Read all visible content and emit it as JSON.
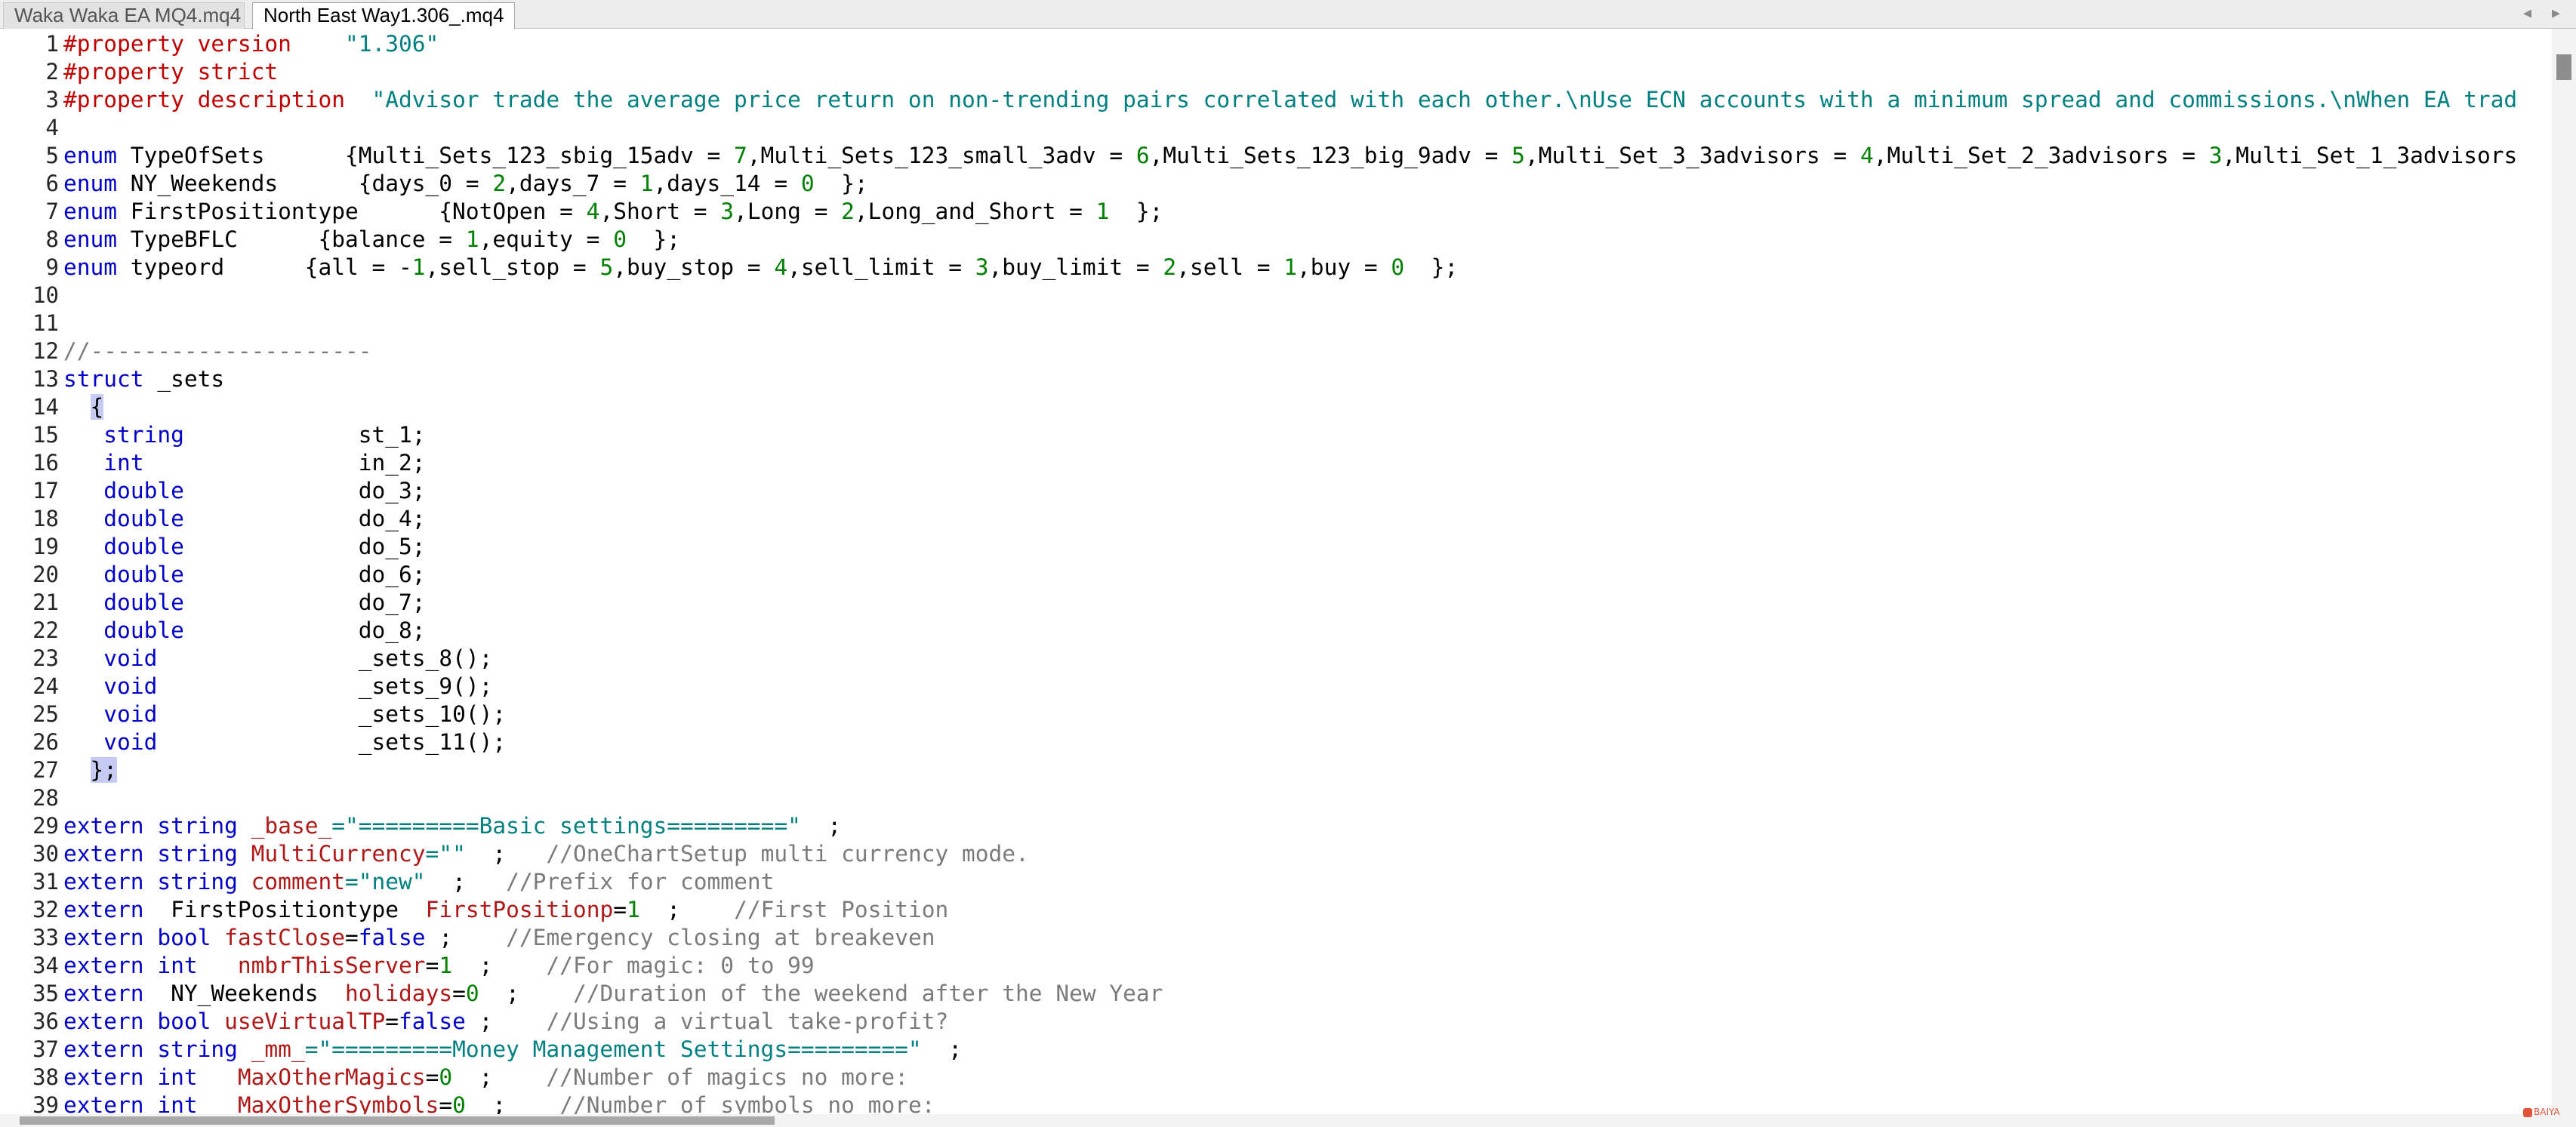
{
  "tabs": [
    {
      "label": "Waka Waka EA MQ4.mq4",
      "active": false
    },
    {
      "label": "North East Way1.306_.mq4",
      "active": true
    }
  ],
  "tab_nav": {
    "prev": "◂",
    "next": "▸"
  },
  "colors": {
    "keyword": "#0000c8",
    "property": "#c00000",
    "string": "#008080",
    "number": "#008000",
    "comment": "#7b7b7b",
    "variable": "#b01818",
    "brace_highlight": "#c5cbf2"
  },
  "lines": [
    [
      [
        "pr",
        "#property version"
      ],
      [
        "",
        "    "
      ],
      [
        "st",
        "\"1.306\""
      ]
    ],
    [
      [
        "pr",
        "#property strict"
      ]
    ],
    [
      [
        "pr",
        "#property description"
      ],
      [
        "",
        "  "
      ],
      [
        "st",
        "\"Advisor trade the average price return on non-trending pairs correlated with each other.\\nUse ECN accounts with a minimum spread and commissions.\\nWhen EA trad"
      ]
    ],
    [],
    [
      [
        "kw",
        "enum"
      ],
      [
        "",
        " TypeOfSets      {Multi_Sets_123_sbig_15adv = "
      ],
      [
        "nm",
        "7"
      ],
      [
        "",
        ",Multi_Sets_123_small_3adv = "
      ],
      [
        "nm",
        "6"
      ],
      [
        "",
        ",Multi_Sets_123_big_9adv = "
      ],
      [
        "nm",
        "5"
      ],
      [
        "",
        ",Multi_Set_3_3advisors = "
      ],
      [
        "nm",
        "4"
      ],
      [
        "",
        ",Multi_Set_2_3advisors = "
      ],
      [
        "nm",
        "3"
      ],
      [
        "",
        ",Multi_Set_1_3advisors"
      ]
    ],
    [
      [
        "kw",
        "enum"
      ],
      [
        "",
        " NY_Weekends      {days_0 = "
      ],
      [
        "nm",
        "2"
      ],
      [
        "",
        ",days_7 = "
      ],
      [
        "nm",
        "1"
      ],
      [
        "",
        ",days_14 = "
      ],
      [
        "nm",
        "0"
      ],
      [
        "",
        "  };"
      ]
    ],
    [
      [
        "kw",
        "enum"
      ],
      [
        "",
        " FirstPositiontype      {NotOpen = "
      ],
      [
        "nm",
        "4"
      ],
      [
        "",
        ",Short = "
      ],
      [
        "nm",
        "3"
      ],
      [
        "",
        ",Long = "
      ],
      [
        "nm",
        "2"
      ],
      [
        "",
        ",Long_and_Short = "
      ],
      [
        "nm",
        "1"
      ],
      [
        "",
        "  };"
      ]
    ],
    [
      [
        "kw",
        "enum"
      ],
      [
        "",
        " TypeBFLC      {balance = "
      ],
      [
        "nm",
        "1"
      ],
      [
        "",
        ",equity = "
      ],
      [
        "nm",
        "0"
      ],
      [
        "",
        "  };"
      ]
    ],
    [
      [
        "kw",
        "enum"
      ],
      [
        "",
        " typeord      {all = -"
      ],
      [
        "nm",
        "1"
      ],
      [
        "",
        ",sell_stop = "
      ],
      [
        "nm",
        "5"
      ],
      [
        "",
        ",buy_stop = "
      ],
      [
        "nm",
        "4"
      ],
      [
        "",
        ",sell_limit = "
      ],
      [
        "nm",
        "3"
      ],
      [
        "",
        ",buy_limit = "
      ],
      [
        "nm",
        "2"
      ],
      [
        "",
        ",sell = "
      ],
      [
        "nm",
        "1"
      ],
      [
        "",
        ",buy = "
      ],
      [
        "nm",
        "0"
      ],
      [
        "",
        "  };"
      ]
    ],
    [],
    [],
    [
      [
        "cm",
        "//---------------------"
      ]
    ],
    [
      [
        "kw",
        "struct"
      ],
      [
        "",
        " _sets"
      ]
    ],
    [
      [
        "",
        "  "
      ],
      [
        "br",
        "{"
      ]
    ],
    [
      [
        "",
        "   "
      ],
      [
        "kw",
        "string"
      ],
      [
        "",
        "             st_1;"
      ]
    ],
    [
      [
        "",
        "   "
      ],
      [
        "kw",
        "int"
      ],
      [
        "",
        "                in_2;"
      ]
    ],
    [
      [
        "",
        "   "
      ],
      [
        "kw",
        "double"
      ],
      [
        "",
        "             do_3;"
      ]
    ],
    [
      [
        "",
        "   "
      ],
      [
        "kw",
        "double"
      ],
      [
        "",
        "             do_4;"
      ]
    ],
    [
      [
        "",
        "   "
      ],
      [
        "kw",
        "double"
      ],
      [
        "",
        "             do_5;"
      ]
    ],
    [
      [
        "",
        "   "
      ],
      [
        "kw",
        "double"
      ],
      [
        "",
        "             do_6;"
      ]
    ],
    [
      [
        "",
        "   "
      ],
      [
        "kw",
        "double"
      ],
      [
        "",
        "             do_7;"
      ]
    ],
    [
      [
        "",
        "   "
      ],
      [
        "kw",
        "double"
      ],
      [
        "",
        "             do_8;"
      ]
    ],
    [
      [
        "",
        "   "
      ],
      [
        "kw",
        "void"
      ],
      [
        "",
        "               _sets_8();"
      ]
    ],
    [
      [
        "",
        "   "
      ],
      [
        "kw",
        "void"
      ],
      [
        "",
        "               _sets_9();"
      ]
    ],
    [
      [
        "",
        "   "
      ],
      [
        "kw",
        "void"
      ],
      [
        "",
        "               _sets_10();"
      ]
    ],
    [
      [
        "",
        "   "
      ],
      [
        "kw",
        "void"
      ],
      [
        "",
        "               _sets_11();"
      ]
    ],
    [
      [
        "",
        "  "
      ],
      [
        "br",
        "};"
      ]
    ],
    [],
    [
      [
        "kw",
        "extern string"
      ],
      [
        "",
        " "
      ],
      [
        "vr",
        "_base_"
      ],
      [
        "st",
        "=\"=========Basic settings=========\""
      ],
      [
        "",
        "  ;"
      ]
    ],
    [
      [
        "kw",
        "extern string"
      ],
      [
        "",
        " "
      ],
      [
        "vr",
        "MultiCurrency"
      ],
      [
        "st",
        "=\"\""
      ],
      [
        "",
        "  ;   "
      ],
      [
        "cm",
        "//OneChartSetup multi currency mode."
      ]
    ],
    [
      [
        "kw",
        "extern string"
      ],
      [
        "",
        " "
      ],
      [
        "vr",
        "comment"
      ],
      [
        "st",
        "=\"new\""
      ],
      [
        "",
        "  ;   "
      ],
      [
        "cm",
        "//Prefix for comment"
      ]
    ],
    [
      [
        "kw",
        "extern"
      ],
      [
        "",
        "  FirstPositiontype  "
      ],
      [
        "vr",
        "FirstPositionp"
      ],
      [
        "",
        "="
      ],
      [
        "nm",
        "1"
      ],
      [
        "",
        "  ;    "
      ],
      [
        "cm",
        "//First Position"
      ]
    ],
    [
      [
        "kw",
        "extern bool"
      ],
      [
        "",
        " "
      ],
      [
        "vr",
        "fastClose"
      ],
      [
        "",
        "="
      ],
      [
        "kw",
        "false"
      ],
      [
        "",
        " ;    "
      ],
      [
        "cm",
        "//Emergency closing at breakeven"
      ]
    ],
    [
      [
        "kw",
        "extern int"
      ],
      [
        "",
        "   "
      ],
      [
        "vr",
        "nmbrThisServer"
      ],
      [
        "",
        "="
      ],
      [
        "nm",
        "1"
      ],
      [
        "",
        "  ;    "
      ],
      [
        "cm",
        "//For magic: 0 to 99"
      ]
    ],
    [
      [
        "kw",
        "extern"
      ],
      [
        "",
        "  NY_Weekends  "
      ],
      [
        "vr",
        "holidays"
      ],
      [
        "",
        "="
      ],
      [
        "nm",
        "0"
      ],
      [
        "",
        "  ;    "
      ],
      [
        "cm",
        "//Duration of the weekend after the New Year"
      ]
    ],
    [
      [
        "kw",
        "extern bool"
      ],
      [
        "",
        " "
      ],
      [
        "vr",
        "useVirtualTP"
      ],
      [
        "",
        "="
      ],
      [
        "kw",
        "false"
      ],
      [
        "",
        " ;    "
      ],
      [
        "cm",
        "//Using a virtual take-profit?"
      ]
    ],
    [
      [
        "kw",
        "extern string"
      ],
      [
        "",
        " "
      ],
      [
        "vr",
        "_mm_"
      ],
      [
        "st",
        "=\"=========Money Management Settings=========\""
      ],
      [
        "",
        "  ;"
      ]
    ],
    [
      [
        "kw",
        "extern int"
      ],
      [
        "",
        "   "
      ],
      [
        "vr",
        "MaxOtherMagics"
      ],
      [
        "",
        "="
      ],
      [
        "nm",
        "0"
      ],
      [
        "",
        "  ;    "
      ],
      [
        "cm",
        "//Number of magics no more:"
      ]
    ],
    [
      [
        "kw",
        "extern int"
      ],
      [
        "",
        "   "
      ],
      [
        "vr",
        "MaxOtherSymbols"
      ],
      [
        "",
        "="
      ],
      [
        "nm",
        "0"
      ],
      [
        "",
        "  ;    "
      ],
      [
        "cm",
        "//Number of symbols no more:"
      ]
    ]
  ],
  "watermark": "BAIYA"
}
